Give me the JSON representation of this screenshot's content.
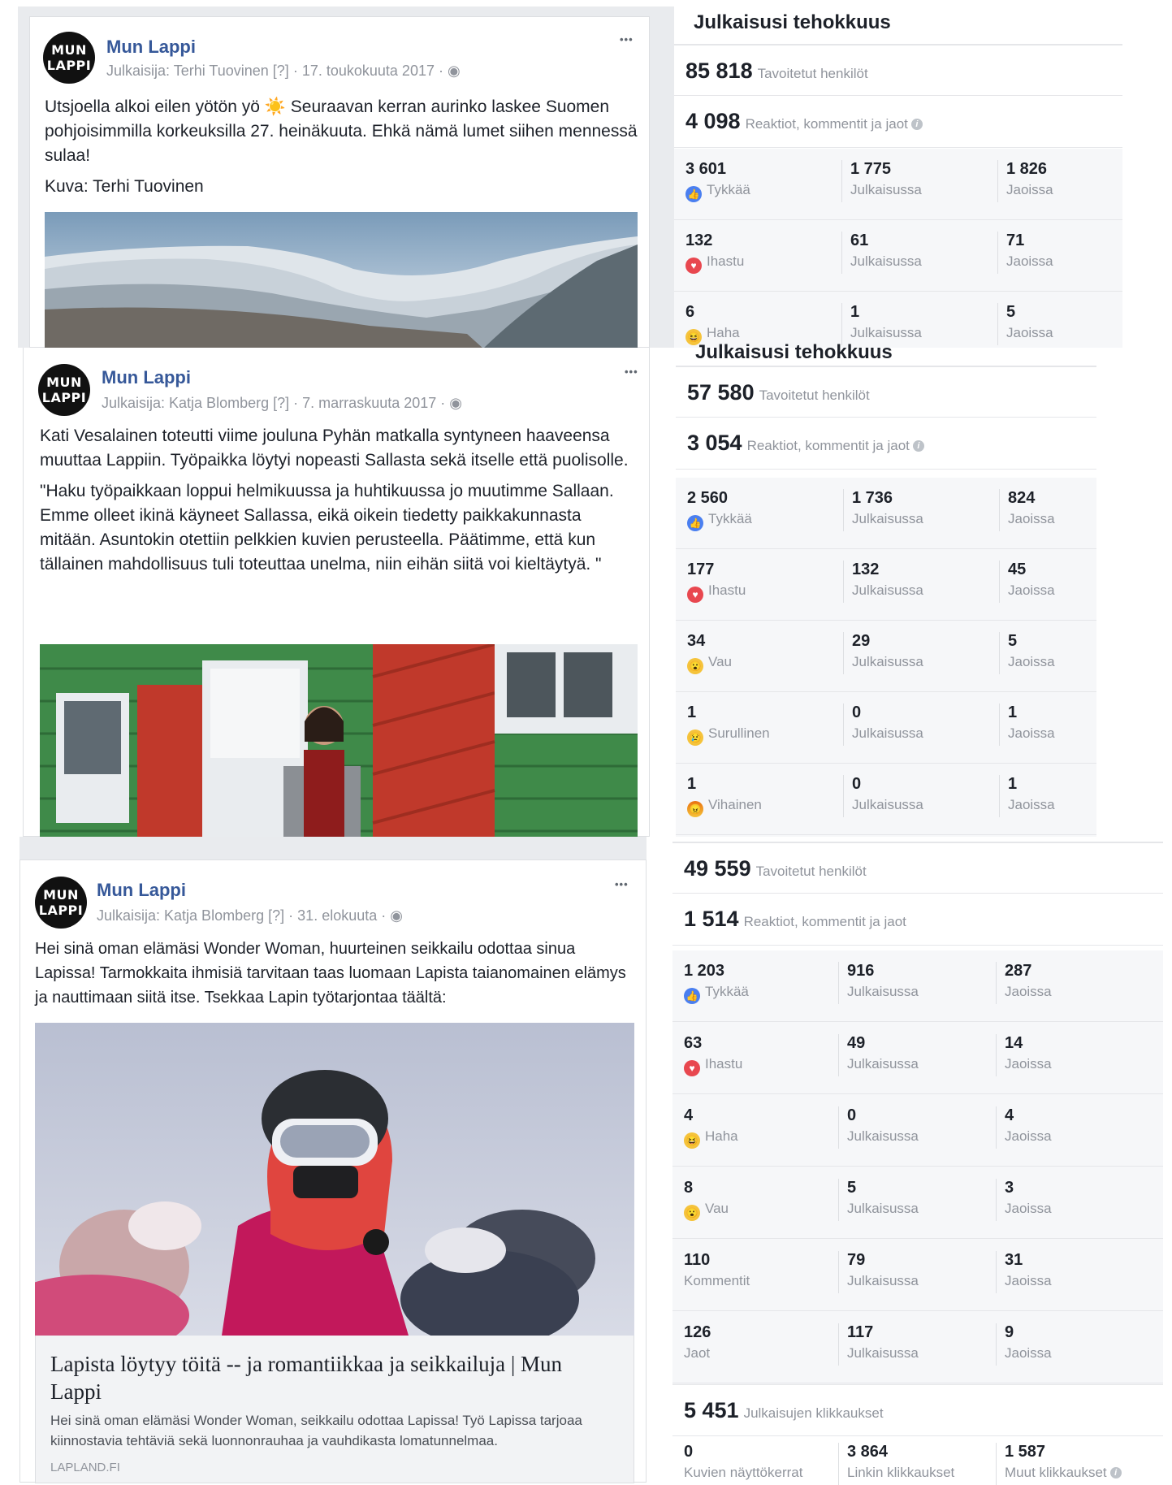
{
  "posts": [
    {
      "page_name": "Mun Lappi",
      "avatar_text": [
        "MUN",
        "LAPPI"
      ],
      "publisher": "Julkaisija: Terhi Tuovinen",
      "help": "[?]",
      "date": "17. toukokuuta 2017",
      "text": [
        "Utsjoella alkoi eilen yötön yö ☀️ Seuraavan kerran aurinko laskee Suomen pohjoisimmilla korkeuksilla 27. heinäkuuta. Ehkä nämä lumet siihen mennessä sulaa!",
        "Kuva: Terhi Tuovinen"
      ]
    },
    {
      "page_name": "Mun Lappi",
      "avatar_text": [
        "MUN",
        "LAPPI"
      ],
      "publisher": "Julkaisija: Katja Blomberg",
      "help": "[?]",
      "date": "7. marraskuuta 2017",
      "text": [
        "Kati Vesalainen toteutti viime jouluna Pyhän matkalla syntyneen haaveensa muuttaa Lappiin. Työpaikka löytyi nopeasti Sallasta sekä itselle että puolisolle.",
        "\"Haku työpaikkaan loppui helmikuussa ja huhtikuussa jo muutimme Sallaan. Emme olleet ikinä käyneet Sallassa, eikä oikein tiedetty paikkakunnasta mitään. Asuntokin otettiin pelkkien kuvien perusteella. Päätimme, että kun tällainen mahdollisuus tuli toteuttaa unelma, niin eihän siitä voi kieltäytyä. \""
      ]
    },
    {
      "page_name": "Mun Lappi",
      "avatar_text": [
        "MUN",
        "LAPPI"
      ],
      "publisher": "Julkaisija: Katja Blomberg",
      "help": "[?]",
      "date": "31. elokuuta",
      "text": [
        "Hei sinä oman elämäsi Wonder Woman, huurteinen seikkailu odottaa sinua Lapissa! Tarmokkaita ihmisiä tarvitaan taas luomaan Lapista taianomainen elämys ja nauttimaan siitä itse. Tsekkaa Lapin työtarjontaa täältä:"
      ],
      "link_title": "Lapista löytyy töitä -- ja romantiikkaa ja seikkailuja | Mun Lappi",
      "link_desc": "Hei sinä oman elämäsi Wonder Woman, seikkailu odottaa Lapissa! Työ Lapissa tarjoaa kiinnostavia tehtäviä sekä luonnonrauhaa ja vauhdikasta lomatunnelmaa.",
      "link_domain": "LAPLAND.FI"
    }
  ],
  "panels": [
    {
      "title": "Julkaisusi tehokkuus",
      "reach": "85 818",
      "reach_label": "Tavoitetut henkilöt",
      "engagement": "4 098",
      "engagement_label": "Reaktiot, kommentit ja jaot",
      "rows": [
        {
          "icon": "like",
          "total": "3 601",
          "label": "Tykkää",
          "on_post": "1 775",
          "on_shares": "1 826"
        },
        {
          "icon": "love",
          "total": "132",
          "label": "Ihastu",
          "on_post": "61",
          "on_shares": "71"
        },
        {
          "icon": "haha",
          "total": "6",
          "label": "Haha",
          "on_post": "1",
          "on_shares": "5"
        }
      ]
    },
    {
      "title": "Julkaisusi tehokkuus",
      "reach": "57 580",
      "reach_label": "Tavoitetut henkilöt",
      "engagement": "3 054",
      "engagement_label": "Reaktiot, kommentit ja jaot",
      "rows": [
        {
          "icon": "like",
          "total": "2 560",
          "label": "Tykkää",
          "on_post": "1 736",
          "on_shares": "824"
        },
        {
          "icon": "love",
          "total": "177",
          "label": "Ihastu",
          "on_post": "132",
          "on_shares": "45"
        },
        {
          "icon": "wow",
          "total": "34",
          "label": "Vau",
          "on_post": "29",
          "on_shares": "5"
        },
        {
          "icon": "sad",
          "total": "1",
          "label": "Surullinen",
          "on_post": "0",
          "on_shares": "1"
        },
        {
          "icon": "angry",
          "total": "1",
          "label": "Vihainen",
          "on_post": "0",
          "on_shares": "1"
        }
      ]
    },
    {
      "reach": "49 559",
      "reach_label": "Tavoitetut henkilöt",
      "engagement": "1 514",
      "engagement_label": "Reaktiot, kommentit ja jaot",
      "rows": [
        {
          "icon": "like",
          "total": "1 203",
          "label": "Tykkää",
          "on_post": "916",
          "on_shares": "287"
        },
        {
          "icon": "love",
          "total": "63",
          "label": "Ihastu",
          "on_post": "49",
          "on_shares": "14"
        },
        {
          "icon": "haha",
          "total": "4",
          "label": "Haha",
          "on_post": "0",
          "on_shares": "4"
        },
        {
          "icon": "wow",
          "total": "8",
          "label": "Vau",
          "on_post": "5",
          "on_shares": "3"
        },
        {
          "icon": "",
          "total": "110",
          "label": "Kommentit",
          "on_post": "79",
          "on_shares": "31"
        },
        {
          "icon": "",
          "total": "126",
          "label": "Jaot",
          "on_post": "117",
          "on_shares": "9"
        }
      ],
      "clicks": "5 451",
      "clicks_label": "Julkaisujen klikkaukset",
      "click_breakdown": [
        {
          "value": "0",
          "label": "Kuvien näyttökerrat"
        },
        {
          "value": "3 864",
          "label": "Linkin klikkaukset"
        },
        {
          "value": "1 587",
          "label": "Muut klikkaukset"
        }
      ]
    }
  ],
  "common": {
    "on_post_label": "Julkaisussa",
    "on_shares_label": "Jaoissa",
    "dots": "•••",
    "info_glyph": "i",
    "sep": "·",
    "globe": "◉"
  },
  "colors": {
    "page_name": "#365899",
    "like": "#4a7ff0",
    "love": "#e8474f",
    "yellow": "#f5c33b"
  }
}
